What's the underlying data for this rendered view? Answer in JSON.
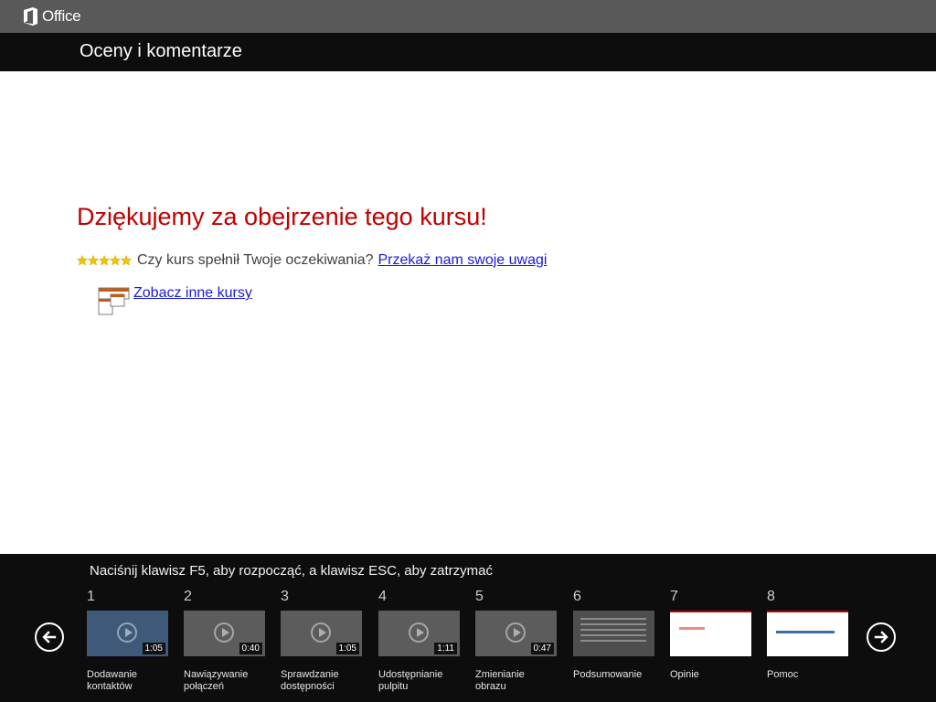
{
  "app": {
    "logo_text": "Office",
    "page_title": "Oceny i komentarze"
  },
  "main": {
    "thanks_heading": "Dziękujemy za obejrzenie tego kursu!",
    "question": "Czy kurs spełnił Twoje oczekiwania?",
    "feedback_link": "Przekaż nam swoje uwagi",
    "courses_link": "Zobacz inne kursy",
    "rating_stars": 5,
    "star_color": "#f5c400",
    "heading_color": "#c00000",
    "link_color": "#1a1adb"
  },
  "bottom": {
    "hint": "Naciśnij klawisz F5, aby rozpocząć, a klawisz ESC, aby zatrzymać",
    "prev_icon": "arrow-left-circle-icon",
    "next_icon": "arrow-right-circle-icon",
    "thumbnails": [
      {
        "num": "1",
        "label": "Dodawanie kontaktów",
        "duration": "1:05"
      },
      {
        "num": "2",
        "label": "Nawiązywanie połączeń",
        "duration": "0:40"
      },
      {
        "num": "3",
        "label": "Sprawdzanie dostępności",
        "duration": "1:05"
      },
      {
        "num": "4",
        "label": "Udostępnianie pulpitu",
        "duration": "1:11"
      },
      {
        "num": "5",
        "label": "Zmienianie obrazu",
        "duration": "0:47"
      },
      {
        "num": "6",
        "label": "Podsumowanie",
        "duration": ""
      },
      {
        "num": "7",
        "label": "Opinie",
        "duration": ""
      },
      {
        "num": "8",
        "label": "Pomoc",
        "duration": ""
      }
    ]
  }
}
